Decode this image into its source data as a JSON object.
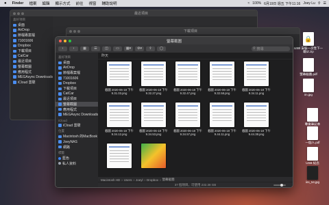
{
  "menubar": {
    "apple": "",
    "items": [
      "Finder",
      "檔案",
      "編輯",
      "顯示方式",
      "前往",
      "視窗",
      "輔助說明"
    ],
    "right": [
      "100%",
      "6月19日 週五 下午11:16",
      "Joey Lu"
    ]
  },
  "back_window": {
    "title": "最近項目",
    "sidebar_head": "喜好項目",
    "items": [
      "桌面",
      "AirDrop",
      "節檔專案檔",
      "71001606",
      "Dropbox",
      "下載項目",
      "CatCar",
      "最近項目",
      "螢幕截圖",
      "應用程式",
      "MEGAsync Downloads"
    ],
    "icloud": "iCloud 雲碟",
    "month": "7月"
  },
  "second_window": {
    "title": "下載項目"
  },
  "main_window": {
    "title": "螢幕截圖",
    "search_placeholder": "搜尋",
    "section_header": "昨天",
    "sidebar": {
      "favorites_head": "喜好項目",
      "favorites": [
        "桌面",
        "AirDrop",
        "節檔專案檔",
        "71001606",
        "Dropbox",
        "下載項目",
        "CatCar",
        "最近項目",
        "螢幕截圖",
        "應用程式",
        "MEGAsync Downloads"
      ],
      "icloud_head": "iCloud",
      "icloud": [
        "iCloud 雲碟"
      ],
      "locations_head": "位置",
      "locations": [
        "Macintosh 的MacBook Pro (2)",
        "JoeyNAS",
        "網路"
      ],
      "tags_head": "標籤",
      "tags": [
        "藍色",
        "私人資料"
      ]
    },
    "files": [
      {
        "line1": "截圖 2020-06-18 下午",
        "line2": "9.31.03.png"
      },
      {
        "line1": "截圖 2020-06-18 下午",
        "line2": "9.32.27.png"
      },
      {
        "line1": "截圖 2020-06-18 下午",
        "line2": "9.32.47.png"
      },
      {
        "line1": "截圖 2020-06-18 下午",
        "line2": "9.32.58.png"
      },
      {
        "line1": "截圖 2020-06-18 下午",
        "line2": "9.34.11.png"
      },
      {
        "line1": "截圖 2020-06-18 下午",
        "line2": "9.34.12.png"
      },
      {
        "line1": "截圖 2020-06-18 下午",
        "line2": "9.34.53.png"
      },
      {
        "line1": "截圖 2020-06-18 下午",
        "line2": "9.34.57.png"
      },
      {
        "line1": "截圖 2020-06-18 下午",
        "line2": "9.44.11.png"
      },
      {
        "line1": "截圖 2020-06-18 下午",
        "line2": "9.44.38.png"
      },
      {
        "line1": "",
        "line2": ""
      },
      {
        "line1": "",
        "line2": ""
      }
    ],
    "path": [
      "Macintosh HD",
      "Users",
      "Joeyl",
      "Dropbox",
      "螢幕截圖"
    ],
    "status": "37 個項目，可使用 232.38 GB"
  },
  "desktop_icons": [
    {
      "label1": "USB 安裝一次性下一",
      "label2": "載IZ.zip"
    },
    {
      "label1": "螢幕截圖.pdf",
      "label2": ""
    },
    {
      "label1": "iin.jpg",
      "label2": ""
    },
    {
      "label1": "專業筆記本",
      "label2": ""
    },
    {
      "label1": "一個人.pdf",
      "label2": ""
    },
    {
      "label1": "USB 紀念",
      "label2": ""
    },
    {
      "label1": "iini_txt.jpg",
      "label2": ""
    }
  ]
}
